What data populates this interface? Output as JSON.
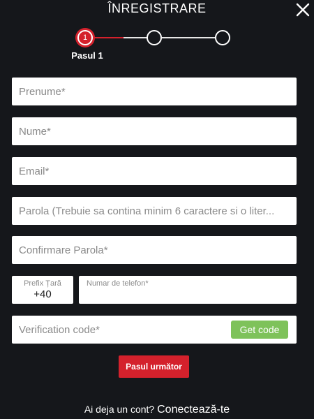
{
  "header": {
    "title": "ÎNREGISTRARE"
  },
  "stepper": {
    "active_step": 1,
    "total_steps": 3,
    "active_number": "1",
    "active_label": "Pasul 1"
  },
  "form": {
    "first_name_placeholder": "Prenume*",
    "last_name_placeholder": "Nume*",
    "email_placeholder": "Email*",
    "password_placeholder": "Parola (Trebuie sa contina minim 6 caractere si o liter...",
    "confirm_password_placeholder": "Confirmare Parola*",
    "country_prefix_label": "Prefix Țară",
    "country_prefix_value": "+40",
    "phone_label": "Numar de telefon*",
    "verification_placeholder": "Verification code*",
    "get_code_label": "Get code",
    "next_label": "Pasul următor"
  },
  "footer": {
    "prompt": "Ai deja un cont?",
    "login_link": "Conectează-te"
  },
  "colors": {
    "background": "#15171b",
    "accent_red": "#d4212c",
    "accent_green": "#7ec25a"
  },
  "icons": {
    "close": "close-icon"
  }
}
